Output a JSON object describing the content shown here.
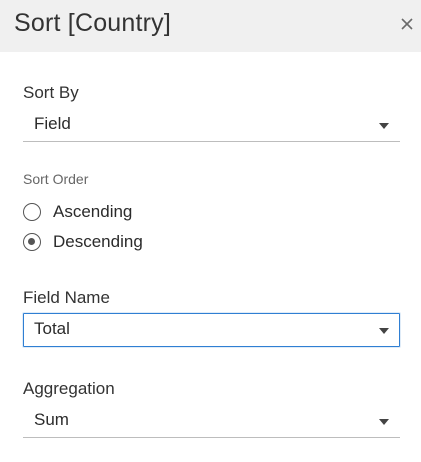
{
  "dialog": {
    "title": "Sort [Country]",
    "close_icon": "close-icon"
  },
  "sort_by": {
    "label": "Sort By",
    "value": "Field"
  },
  "sort_order": {
    "label": "Sort Order",
    "options": [
      {
        "label": "Ascending",
        "selected": false
      },
      {
        "label": "Descending",
        "selected": true
      }
    ]
  },
  "field_name": {
    "label": "Field Name",
    "value": "Total"
  },
  "aggregation": {
    "label": "Aggregation",
    "value": "Sum"
  },
  "colors": {
    "header_bg": "#f0f0f0",
    "focus_border": "#2f7fd3",
    "underline": "#bdbdbd"
  }
}
